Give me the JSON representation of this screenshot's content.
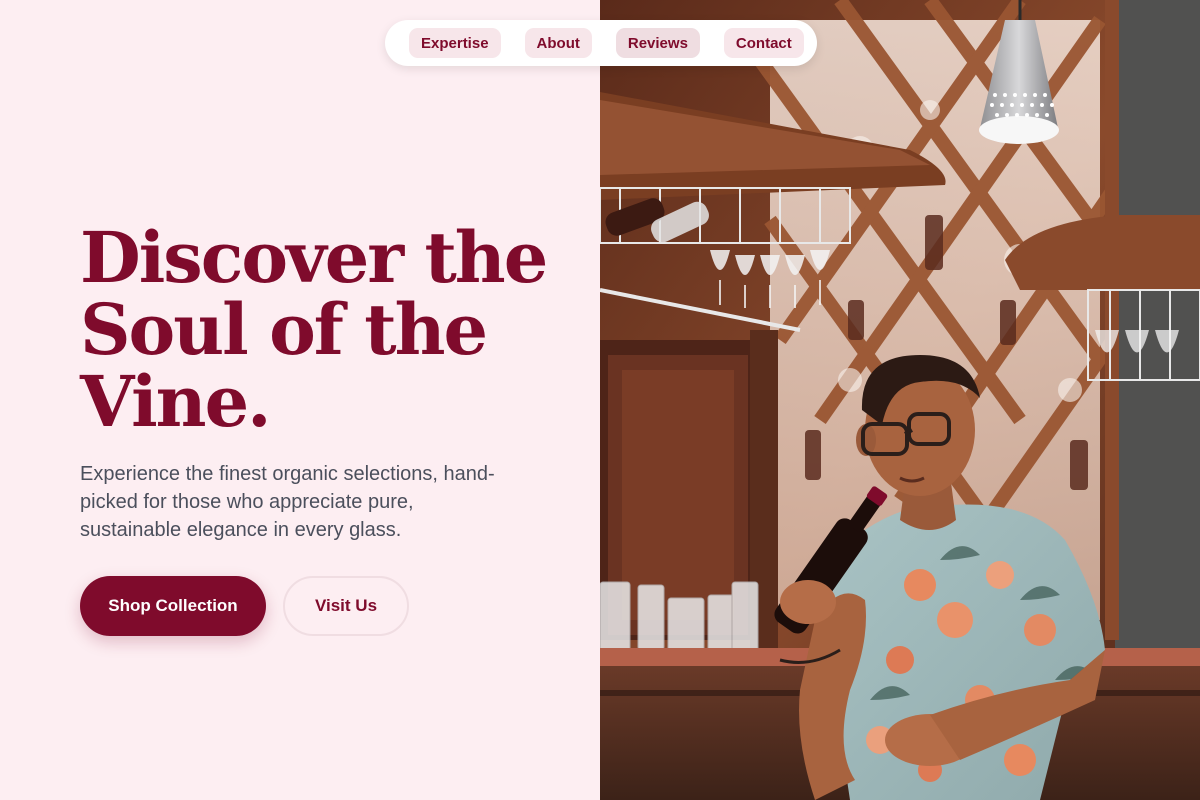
{
  "nav": {
    "items": [
      {
        "label": "Expertise"
      },
      {
        "label": "About"
      },
      {
        "label": "Reviews"
      },
      {
        "label": "Contact"
      }
    ]
  },
  "hero": {
    "headline_lines": [
      "Discover the",
      "Soul of the",
      "Vine."
    ],
    "lede": "Experience the finest organic selections, hand-picked for those who appreciate pure, sustainable elegance in every glass.",
    "primary_cta": "Shop Collection",
    "secondary_cta": "Visit Us"
  },
  "colors": {
    "background": "#fdeef2",
    "brand": "#7f0b2c",
    "text_muted": "#4b4f5c"
  }
}
